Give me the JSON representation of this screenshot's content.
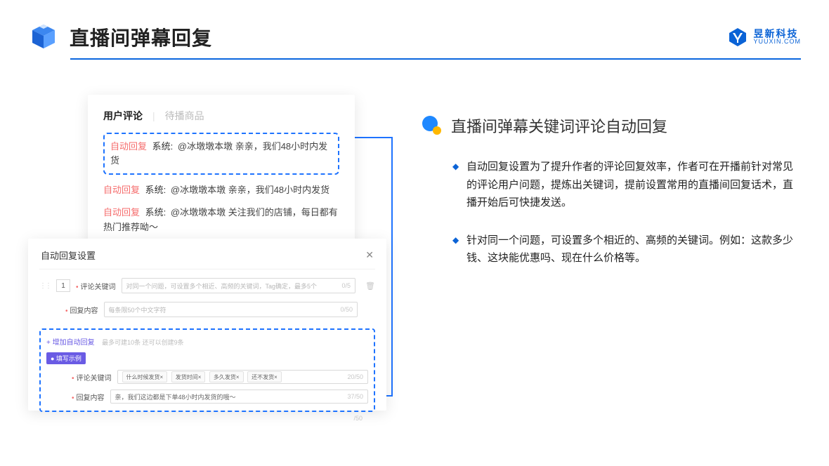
{
  "header": {
    "title": "直播间弹幕回复",
    "brand_cn": "昱新科技",
    "brand_en": "YUUXIN.COM"
  },
  "left": {
    "card1": {
      "tab_active": "用户评论",
      "tab_inactive": "待播商品",
      "items": [
        {
          "auto": "自动回复",
          "sys": "系统:",
          "text": "@冰墩墩本墩 亲亲，我们48小时内发货"
        },
        {
          "auto": "自动回复",
          "sys": "系统:",
          "text": "@冰墩墩本墩 亲亲，我们48小时内发货"
        },
        {
          "auto": "自动回复",
          "sys": "系统:",
          "text": "@冰墩墩本墩 关注我们的店铺，每日都有热门推荐呦～"
        }
      ]
    },
    "card2": {
      "title": "自动回复设置",
      "num": "1",
      "label_keyword": "评论关键词",
      "placeholder_keyword": "对同一个问题，可设置多个相近、高频的关键词，Tag确定，最多5个",
      "count_keyword": "0/5",
      "label_content": "回复内容",
      "placeholder_content": "每条限50个中文字符",
      "count_content": "0/50",
      "add_text": "+ 增加自动回复",
      "add_info": "最多可建10条 还可以创建9条",
      "badge": "● 填写示例",
      "ex_label_keyword": "评论关键词",
      "ex_tags": [
        "什么时候发货×",
        "发货时间×",
        "多久发货×",
        "还不发货×"
      ],
      "ex_count_keyword": "20/50",
      "ex_label_content": "回复内容",
      "ex_content": "亲，我们这边都是下单48小时内发货的哦～",
      "ex_count_content": "37/50",
      "trailing_count": "/50"
    }
  },
  "right": {
    "title": "直播间弹幕关键词评论自动回复",
    "bullets": [
      "自动回复设置为了提升作者的评论回复效率，作者可在开播前针对常见的评论用户问题，提炼出关键词，提前设置常用的直播间回复话术，直播开始后可快捷发送。",
      "针对同一个问题，可设置多个相近的、高频的关键词。例如：这款多少钱、这块能优惠吗、现在什么价格等。"
    ]
  }
}
